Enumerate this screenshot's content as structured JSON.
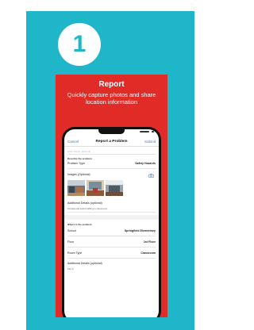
{
  "step": {
    "number": "1"
  },
  "card": {
    "title": "Report",
    "subtitle": "Quickly capture photos and share location information"
  },
  "phone": {
    "nav": {
      "cancel": "Cancel",
      "title": "Report a Problem",
      "submit": "Submit"
    },
    "placeholder": "Short Name (optional)",
    "describe_header": "Describe the problem",
    "problem_type": {
      "label": "Problem Type",
      "value": "Safety Hazards"
    },
    "images_label": "Images (Optional)",
    "additional_details_label": "Additional Details (optional)",
    "additional_details_text": "Occasional debris falling in classroom",
    "where_header": "Where is the problem",
    "school": {
      "label": "School",
      "value": "Springfield Elementary"
    },
    "floor": {
      "label": "Floor",
      "value": "1st Floor"
    },
    "room_type": {
      "label": "Room Type",
      "value": "Classroom"
    },
    "additional_details_label_2": "Additional Details (optional)",
    "additional_details_text_2": "Fire 6"
  },
  "colors": {
    "tile_background": "#1fb6c9",
    "card_background": "#e02b27",
    "link": "#2a7be4"
  },
  "icons": {
    "camera": "camera-icon"
  }
}
